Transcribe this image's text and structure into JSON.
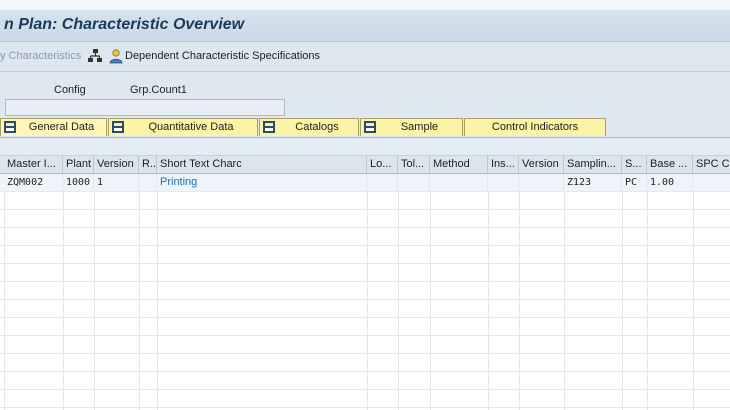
{
  "window": {
    "title": "n Plan: Characteristic Overview"
  },
  "toolbar": {
    "characteristics_label": "y Characteristics",
    "dependent_specs_label": "Dependent Characteristic Specifications",
    "icons": [
      "hierarchy-icon",
      "person-icon"
    ]
  },
  "header": {
    "config_label": "Config",
    "grp_count_label": "Grp.Count1",
    "field_value": ""
  },
  "tabs": [
    {
      "label": "General Data"
    },
    {
      "label": "Quantitative Data"
    },
    {
      "label": "Catalogs"
    },
    {
      "label": "Sample"
    },
    {
      "label": "Control Indicators"
    }
  ],
  "table": {
    "columns": [
      "Master I...",
      "Plant",
      "Version",
      "R..",
      "Short Text Charc",
      "Lo...",
      "Tol...",
      "Method",
      "Ins...",
      "Version",
      "Samplin...",
      "S...",
      "Base ...",
      "SPC Cr"
    ],
    "rows": [
      {
        "master": "ZQM002",
        "plant": "1000",
        "version": "1",
        "r": "",
        "short_text": "Printing",
        "lo": "",
        "tol": "",
        "method": "",
        "ins": "",
        "version2": "",
        "sampling": "Z123",
        "s": "PC",
        "base": "1.00",
        "spc": ""
      }
    ]
  },
  "colors": {
    "title_bar": "#c9d9e7",
    "tab_yellow": "#fbf3a6",
    "link_blue": "#1f6db5"
  }
}
